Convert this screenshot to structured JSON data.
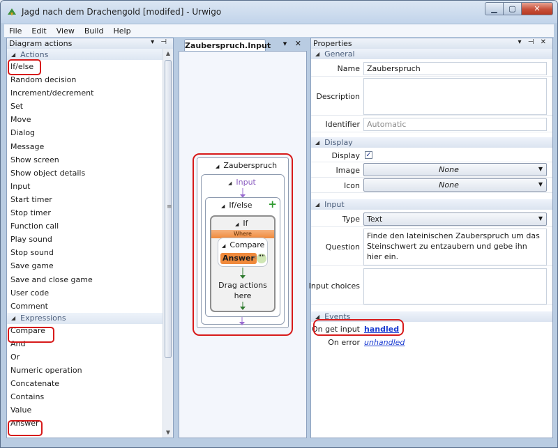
{
  "window": {
    "title": "Jagd nach dem Drachengold [modifed] - Urwigo"
  },
  "menu": [
    "File",
    "Edit",
    "View",
    "Build",
    "Help"
  ],
  "left_panel": {
    "title": "Diagram actions",
    "header_tools": "▾ ⊣",
    "actions_group": "Actions",
    "actions": [
      "If/else",
      "Random decision",
      "Increment/decrement",
      "Set",
      "Move",
      "Dialog",
      "Message",
      "Show screen",
      "Show object details",
      "Input",
      "Start timer",
      "Stop timer",
      "Function call",
      "Play sound",
      "Stop sound",
      "Save game",
      "Save and close game",
      "User code",
      "Comment"
    ],
    "expressions_group": "Expressions",
    "expressions": [
      "Compare",
      "And",
      "Or",
      "Numeric operation",
      "Concatenate",
      "Contains",
      "Value",
      "Answer"
    ]
  },
  "middle_panel": {
    "tab": "Zauberspruch.Input",
    "tab_tools": "▾ ✕",
    "diagram": {
      "root": "Zauberspruch",
      "event": "Input",
      "ifelse": "If/else",
      "add": "+",
      "if_block": "If",
      "where": "Where",
      "compare": "Compare",
      "answer": "Answer",
      "op": "=",
      "literal": "\"\"",
      "drag_hint_1": "Drag actions",
      "drag_hint_2": "here"
    }
  },
  "right_panel": {
    "title": "Properties",
    "header_tools": "▾ ⊣ ✕",
    "general": {
      "header": "General",
      "name_label": "Name",
      "name_value": "Zauberspruch",
      "description_label": "Description",
      "description_value": "",
      "identifier_label": "Identifier",
      "identifier_value": "Automatic"
    },
    "display": {
      "header": "Display",
      "display_label": "Display",
      "display_checked": "✓",
      "image_label": "Image",
      "image_value": "None",
      "icon_label": "Icon",
      "icon_value": "None"
    },
    "input": {
      "header": "Input",
      "type_label": "Type",
      "type_value": "Text",
      "question_label": "Question",
      "question_value": "Finde den lateinischen Zauberspruch um das Steinschwert zu entzaubern und gebe ihn hier ein.",
      "choices_label": "Input choices",
      "choices_value": ""
    },
    "events": {
      "header": "Events",
      "get_input_label": "On get input",
      "get_input_value": "handled",
      "error_label": "On error",
      "error_value": "unhandled"
    }
  },
  "colors": {
    "highlight": "#d71a1a",
    "link": "#1a3bd1",
    "accent_orange": "#f08a3c"
  }
}
